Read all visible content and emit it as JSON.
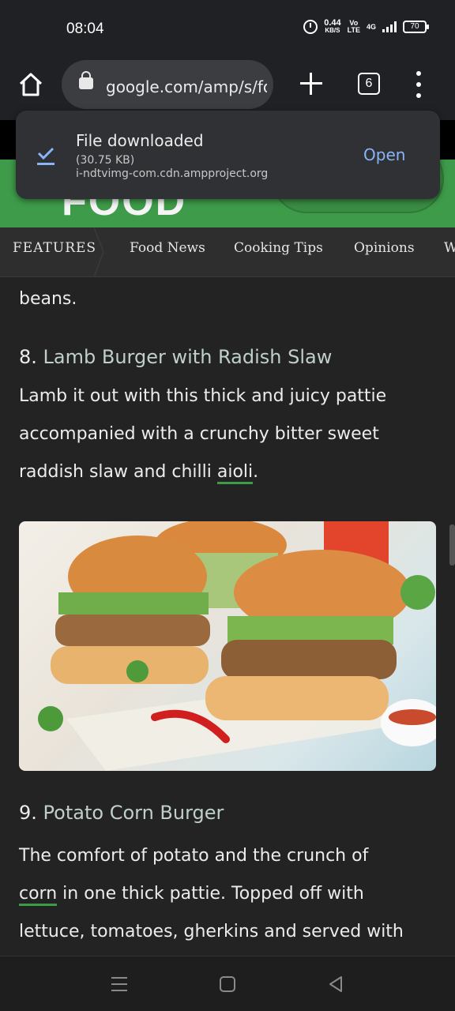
{
  "status_bar": {
    "time": "08:04",
    "net_speed": "0.44",
    "net_unit": "KB/S",
    "volte_top": "Vo",
    "volte_bottom": "LTE",
    "network": "4G",
    "battery": "70"
  },
  "toolbar": {
    "url": "google.com/amp/s/food.ndtv.com",
    "tab_count": "6"
  },
  "toast": {
    "title": "File downloaded",
    "size": "(30.75 KB)",
    "host": "i-ndtvimg-com.cdn.ampproject.org",
    "action": "Open"
  },
  "site": {
    "logo": "FOOD"
  },
  "category_nav": {
    "items": [
      "FEATURES",
      "Food News",
      "Cooking Tips",
      "Opinions",
      "W"
    ]
  },
  "article": {
    "tail_text": "beans.",
    "item8": {
      "number": "8.",
      "title": "Lamb Burger with Radish Slaw",
      "body_before_link": "Lamb it out with this thick and juicy pattie accompanied with a crunchy bitter sweet raddish slaw and chilli ",
      "link": "aioli",
      "body_after_link": "."
    },
    "item9": {
      "number": "9.",
      "title": "Potato Corn Burger",
      "body_line1": "The comfort of potato and the crunch of",
      "link": "corn",
      "body_after_link": " in one thick pattie. Topped off with",
      "body_line3": "lettuce, tomatoes, gherkins and served with"
    }
  },
  "colors": {
    "accent_green": "#3e9b4a",
    "link_blue": "#8ab4f8",
    "background": "#232323"
  }
}
